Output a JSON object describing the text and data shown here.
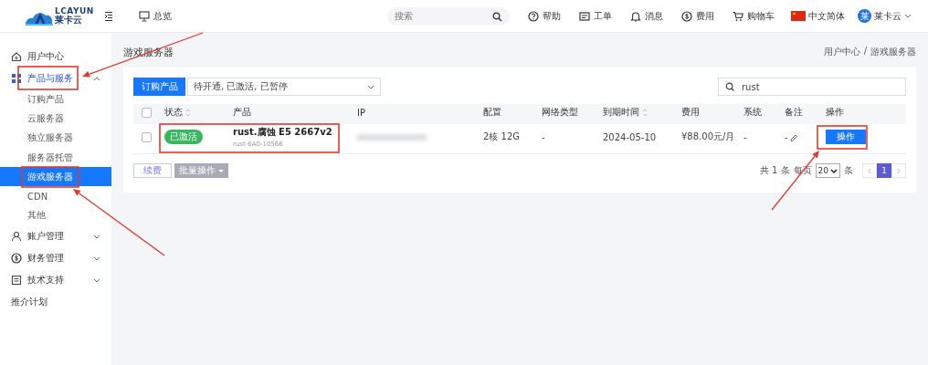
{
  "header": {
    "logo": {
      "brand": "LCAYUN",
      "name": "莱卡云"
    },
    "overview": "总览",
    "search": {
      "placeholder": "搜索"
    },
    "actions": [
      {
        "kind": "help",
        "label": "帮助"
      },
      {
        "kind": "ticket",
        "label": "工单"
      },
      {
        "kind": "bell",
        "label": "消息"
      },
      {
        "kind": "coin",
        "label": "费用"
      },
      {
        "kind": "cart",
        "label": "购物车"
      }
    ],
    "language": "中文简体",
    "user": {
      "avatar": "莱",
      "name": "莱卡云"
    }
  },
  "sidebar": {
    "items": [
      {
        "kind": "home",
        "label": "用户中心",
        "selected": false
      },
      {
        "kind": "grid",
        "label": "产品与服务",
        "selected": false,
        "expanded": true,
        "children": [
          {
            "label": "订购产品",
            "selected": false
          },
          {
            "label": "云服务器",
            "selected": false
          },
          {
            "label": "独立服务器",
            "selected": false
          },
          {
            "label": "服务器托管",
            "selected": false
          },
          {
            "label": "游戏服务器",
            "selected": true
          },
          {
            "label": "CDN",
            "selected": false
          },
          {
            "label": "其他",
            "selected": false
          }
        ]
      },
      {
        "kind": "user",
        "label": "账户管理",
        "selected": false,
        "expanded": false
      },
      {
        "kind": "coin",
        "label": "财务管理",
        "selected": false,
        "expanded": false
      },
      {
        "kind": "doc",
        "label": "技术支持",
        "selected": false,
        "expanded": false
      },
      {
        "kind": "plain",
        "label": "推介计划",
        "selected": false
      }
    ]
  },
  "page": {
    "title": "游戏服务器",
    "breadcrumb": [
      "用户中心",
      "游戏服务器"
    ],
    "breadcrumb_separator": "/"
  },
  "toolbar": {
    "order_button": "订购产品",
    "status_filter": "待开通, 已激活, 已暂停",
    "search": "rust"
  },
  "table": {
    "all_checked": false,
    "columns": [
      {
        "label": "状态",
        "sortable": true
      },
      {
        "label": "产品",
        "sortable": false
      },
      {
        "label": "IP",
        "sortable": false
      },
      {
        "label": "配置",
        "sortable": false
      },
      {
        "label": "网络类型",
        "sortable": false
      },
      {
        "label": "到期时间",
        "sortable": true
      },
      {
        "label": "费用",
        "sortable": false
      },
      {
        "label": "系统",
        "sortable": false
      },
      {
        "label": "备注",
        "sortable": false
      },
      {
        "label": "操作",
        "sortable": false
      }
    ],
    "rows": [
      {
        "checked": false,
        "status": "已激活",
        "product": "rust.腐蚀 E5 2667v2",
        "product_id": "rust-6A0-10566",
        "config": "2核 12G",
        "network": "-",
        "expiry": "2024-05-10",
        "fee": "¥88.00元/月",
        "system": "-",
        "note": "-",
        "action": "操作"
      }
    ]
  },
  "footer": {
    "renew": "续费",
    "batch": "批量操作",
    "total": "共 1 条",
    "per_page_label": "每页",
    "per_page": "20",
    "unit": "条",
    "pages": [
      {
        "label": "1",
        "selected": true
      }
    ]
  },
  "annotations": [
    {
      "kind": "frame"
    },
    {
      "kind": "frame"
    },
    {
      "kind": "frame"
    },
    {
      "kind": "frame"
    },
    {
      "kind": "arrow"
    },
    {
      "kind": "arrow"
    },
    {
      "kind": "arrow"
    }
  ]
}
